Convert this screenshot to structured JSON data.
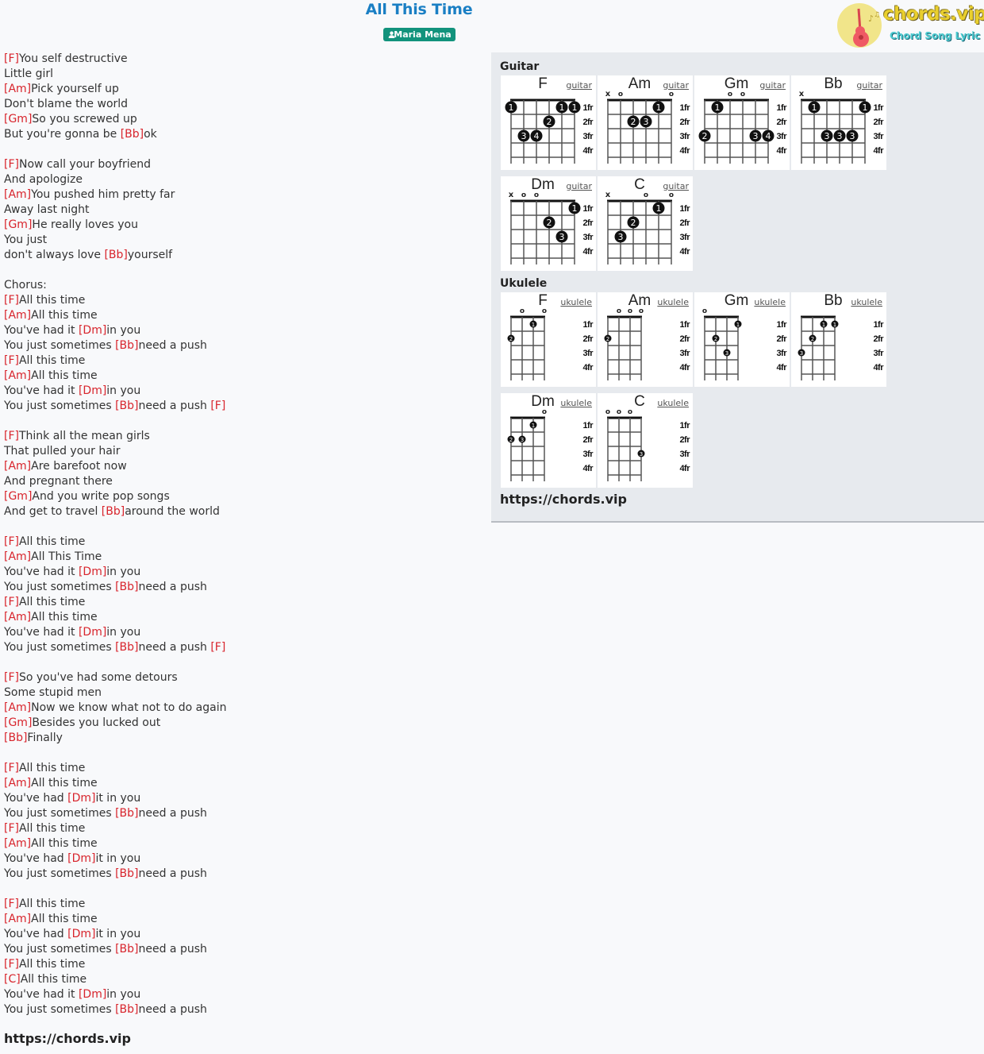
{
  "header": {
    "title": "All This Time",
    "artist": "Maria Mena",
    "artist_icon": "user-icon"
  },
  "logo": {
    "text": "chords.vip",
    "subtext": "Chord Song Lyric",
    "icon": "guitar-icon"
  },
  "lyrics": [
    [
      {
        "c": "F"
      },
      {
        "t": "You self destructive"
      }
    ],
    [
      {
        "t": "Little girl"
      }
    ],
    [
      {
        "c": "Am"
      },
      {
        "t": "Pick yourself up"
      }
    ],
    [
      {
        "t": "Don't blame the world"
      }
    ],
    [
      {
        "c": "Gm"
      },
      {
        "t": "So you screwed up"
      }
    ],
    [
      {
        "t": "But you're gonna be "
      },
      {
        "c": "Bb"
      },
      {
        "t": "ok"
      }
    ],
    [],
    [
      {
        "c": "F"
      },
      {
        "t": "Now call your boyfriend"
      }
    ],
    [
      {
        "t": "And apologize"
      }
    ],
    [
      {
        "c": "Am"
      },
      {
        "t": "You pushed him pretty far"
      }
    ],
    [
      {
        "t": "Away last night"
      }
    ],
    [
      {
        "c": "Gm"
      },
      {
        "t": "He really loves you"
      }
    ],
    [
      {
        "t": "You just"
      }
    ],
    [
      {
        "t": "don't always love "
      },
      {
        "c": "Bb"
      },
      {
        "t": "yourself"
      }
    ],
    [],
    [
      {
        "t": "Chorus:"
      }
    ],
    [
      {
        "c": "F"
      },
      {
        "t": "All this time"
      }
    ],
    [
      {
        "c": "Am"
      },
      {
        "t": "All this time"
      }
    ],
    [
      {
        "t": "You've had it "
      },
      {
        "c": "Dm"
      },
      {
        "t": "in you"
      }
    ],
    [
      {
        "t": "You just sometimes "
      },
      {
        "c": "Bb"
      },
      {
        "t": "need a push"
      }
    ],
    [
      {
        "c": "F"
      },
      {
        "t": "All this time"
      }
    ],
    [
      {
        "c": "Am"
      },
      {
        "t": "All this time"
      }
    ],
    [
      {
        "t": "You've had it "
      },
      {
        "c": "Dm"
      },
      {
        "t": "in you"
      }
    ],
    [
      {
        "t": "You just sometimes "
      },
      {
        "c": "Bb"
      },
      {
        "t": "need a push "
      },
      {
        "c": "F"
      }
    ],
    [],
    [
      {
        "c": "F"
      },
      {
        "t": "Think all the mean girls"
      }
    ],
    [
      {
        "t": "That pulled your hair"
      }
    ],
    [
      {
        "c": "Am"
      },
      {
        "t": "Are barefoot now"
      }
    ],
    [
      {
        "t": "And pregnant there"
      }
    ],
    [
      {
        "c": "Gm"
      },
      {
        "t": "And you write pop songs"
      }
    ],
    [
      {
        "t": "And get to travel "
      },
      {
        "c": "Bb"
      },
      {
        "t": "around the world"
      }
    ],
    [],
    [
      {
        "c": "F"
      },
      {
        "t": "All this time"
      }
    ],
    [
      {
        "c": "Am"
      },
      {
        "t": "All This Time"
      }
    ],
    [
      {
        "t": "You've had it "
      },
      {
        "c": "Dm"
      },
      {
        "t": "in you"
      }
    ],
    [
      {
        "t": "You just sometimes "
      },
      {
        "c": "Bb"
      },
      {
        "t": "need a push"
      }
    ],
    [
      {
        "c": "F"
      },
      {
        "t": "All this time"
      }
    ],
    [
      {
        "c": "Am"
      },
      {
        "t": "All this time"
      }
    ],
    [
      {
        "t": "You've had it "
      },
      {
        "c": "Dm"
      },
      {
        "t": "in you"
      }
    ],
    [
      {
        "t": "You just sometimes "
      },
      {
        "c": "Bb"
      },
      {
        "t": "need a push "
      },
      {
        "c": "F"
      }
    ],
    [],
    [
      {
        "c": "F"
      },
      {
        "t": "So you've had some detours"
      }
    ],
    [
      {
        "t": "Some stupid men"
      }
    ],
    [
      {
        "c": "Am"
      },
      {
        "t": "Now we know what not to do again"
      }
    ],
    [
      {
        "c": "Gm"
      },
      {
        "t": "Besides you lucked out"
      }
    ],
    [
      {
        "c": "Bb"
      },
      {
        "t": "Finally"
      }
    ],
    [],
    [
      {
        "c": "F"
      },
      {
        "t": "All this time"
      }
    ],
    [
      {
        "c": "Am"
      },
      {
        "t": "All this time"
      }
    ],
    [
      {
        "t": "You've had "
      },
      {
        "c": "Dm"
      },
      {
        "t": "it in you"
      }
    ],
    [
      {
        "t": "You just sometimes "
      },
      {
        "c": "Bb"
      },
      {
        "t": "need a push"
      }
    ],
    [
      {
        "c": "F"
      },
      {
        "t": "All this time"
      }
    ],
    [
      {
        "c": "Am"
      },
      {
        "t": "All this time"
      }
    ],
    [
      {
        "t": "You've had "
      },
      {
        "c": "Dm"
      },
      {
        "t": "it in you"
      }
    ],
    [
      {
        "t": "You just sometimes "
      },
      {
        "c": "Bb"
      },
      {
        "t": "need a push"
      }
    ],
    [],
    [
      {
        "c": "F"
      },
      {
        "t": "All this time"
      }
    ],
    [
      {
        "c": "Am"
      },
      {
        "t": "All this time"
      }
    ],
    [
      {
        "t": "You've had "
      },
      {
        "c": "Dm"
      },
      {
        "t": "it in you"
      }
    ],
    [
      {
        "t": "You just sometimes "
      },
      {
        "c": "Bb"
      },
      {
        "t": "need a push"
      }
    ],
    [
      {
        "c": "F"
      },
      {
        "t": "All this time"
      }
    ],
    [
      {
        "c": "C"
      },
      {
        "t": "All this time"
      }
    ],
    [
      {
        "t": "You've had it "
      },
      {
        "c": "Dm"
      },
      {
        "t": "in you"
      }
    ],
    [
      {
        "t": "You just sometimes "
      },
      {
        "c": "Bb"
      },
      {
        "t": "need a push"
      }
    ]
  ],
  "lyrics_footer": "https://chords.vip",
  "panel": {
    "guitar_label": "Guitar",
    "ukulele_label": "Ukulele",
    "footer": "https://chords.vip",
    "fret_labels": [
      "1fr",
      "2fr",
      "3fr",
      "4fr"
    ],
    "guitar": [
      {
        "name": "F",
        "link": "guitar",
        "open": [
          "",
          "",
          "",
          "",
          "",
          ""
        ],
        "dots": [
          [
            1,
            1,
            "1"
          ],
          [
            5,
            1,
            "1"
          ],
          [
            6,
            1,
            "1"
          ],
          [
            4,
            2,
            "2"
          ],
          [
            2,
            3,
            "3"
          ],
          [
            3,
            3,
            "4"
          ]
        ]
      },
      {
        "name": "Am",
        "link": "guitar",
        "open": [
          "x",
          "o",
          "",
          "",
          "",
          "o"
        ],
        "dots": [
          [
            5,
            1,
            "1"
          ],
          [
            3,
            2,
            "2"
          ],
          [
            4,
            2,
            "3"
          ]
        ]
      },
      {
        "name": "Gm",
        "link": "guitar",
        "open": [
          "",
          "",
          "o",
          "o",
          "",
          ""
        ],
        "dots": [
          [
            2,
            1,
            "1"
          ],
          [
            1,
            3,
            "2"
          ],
          [
            5,
            3,
            "3"
          ],
          [
            6,
            3,
            "4"
          ]
        ]
      },
      {
        "name": "Bb",
        "link": "guitar",
        "open": [
          "x",
          "",
          "",
          "",
          "",
          ""
        ],
        "dots": [
          [
            2,
            1,
            "1"
          ],
          [
            6,
            1,
            "1"
          ],
          [
            3,
            3,
            "3"
          ],
          [
            4,
            3,
            "3"
          ],
          [
            5,
            3,
            "3"
          ]
        ]
      },
      {
        "name": "Dm",
        "link": "guitar",
        "open": [
          "x",
          "o",
          "o",
          "",
          "",
          ""
        ],
        "dots": [
          [
            6,
            1,
            "1"
          ],
          [
            4,
            2,
            "2"
          ],
          [
            5,
            3,
            "3"
          ]
        ]
      },
      {
        "name": "C",
        "link": "guitar",
        "open": [
          "x",
          "",
          "",
          "o",
          "",
          "o"
        ],
        "dots": [
          [
            5,
            1,
            "1"
          ],
          [
            3,
            2,
            "2"
          ],
          [
            2,
            3,
            "3"
          ]
        ]
      }
    ],
    "ukulele": [
      {
        "name": "F",
        "link": "ukulele",
        "open": [
          "",
          "o",
          "",
          "o"
        ],
        "dots": [
          [
            3,
            1,
            "1"
          ],
          [
            1,
            2,
            "2"
          ]
        ]
      },
      {
        "name": "Am",
        "link": "ukulele",
        "open": [
          "",
          "o",
          "o",
          "o"
        ],
        "dots": [
          [
            1,
            2,
            "2"
          ]
        ]
      },
      {
        "name": "Gm",
        "link": "ukulele",
        "open": [
          "o",
          "",
          "",
          ""
        ],
        "dots": [
          [
            4,
            1,
            "1"
          ],
          [
            2,
            2,
            "2"
          ],
          [
            3,
            3,
            "3"
          ]
        ]
      },
      {
        "name": "Bb",
        "link": "ukulele",
        "open": [
          "",
          "",
          "",
          ""
        ],
        "dots": [
          [
            3,
            1,
            "1"
          ],
          [
            4,
            1,
            "1"
          ],
          [
            2,
            2,
            "2"
          ],
          [
            1,
            3,
            "3"
          ]
        ]
      },
      {
        "name": "Dm",
        "link": "ukulele",
        "open": [
          "",
          "",
          "",
          "o"
        ],
        "dots": [
          [
            3,
            1,
            "1"
          ],
          [
            1,
            2,
            "2"
          ],
          [
            2,
            2,
            "3"
          ]
        ]
      },
      {
        "name": "C",
        "link": "ukulele",
        "open": [
          "o",
          "o",
          "o",
          ""
        ],
        "dots": [
          [
            4,
            3,
            "3"
          ]
        ]
      }
    ]
  }
}
